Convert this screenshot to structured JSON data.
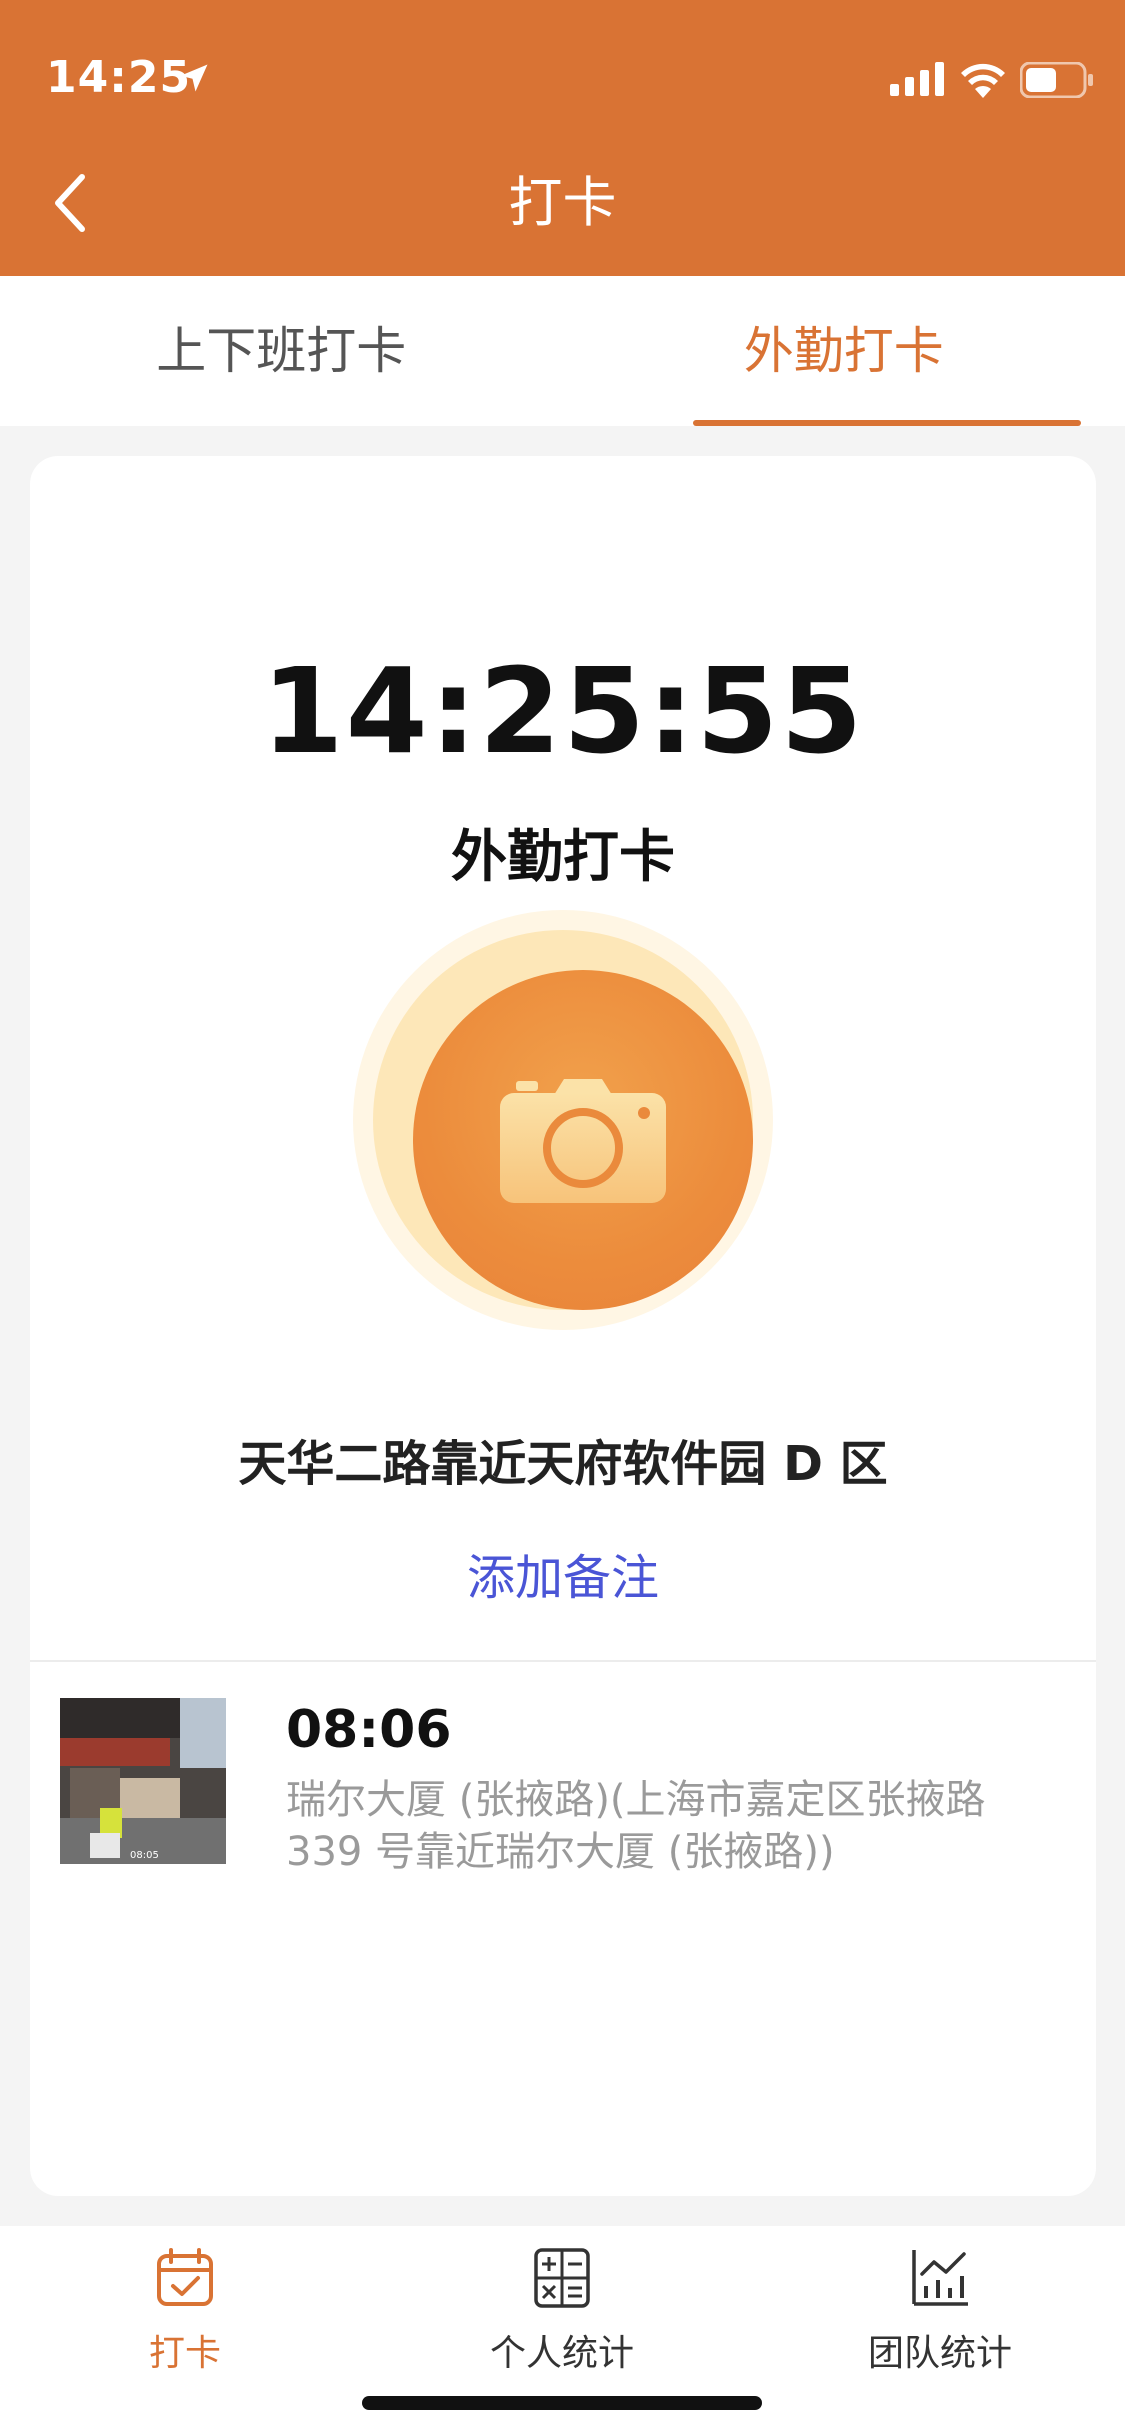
{
  "status_bar": {
    "time": "14:25",
    "icons": [
      "location-arrow-icon",
      "cellular-signal-icon",
      "wifi-icon",
      "battery-icon"
    ]
  },
  "header": {
    "title": "打卡",
    "back_icon": "chevron-left-icon",
    "background_color": "#d97334"
  },
  "tabs": [
    {
      "label": "上下班打卡",
      "active": false
    },
    {
      "label": "外勤打卡",
      "active": true
    }
  ],
  "punch_card": {
    "clock": "14:25:55",
    "mode": "外勤打卡",
    "button_icon": "camera-icon",
    "location": "天华二路靠近天府软件园 D 区",
    "add_note_label": "添加备注"
  },
  "records": [
    {
      "time": "08:06",
      "address": "瑞尔大厦 (张掖路)(上海市嘉定区张掖路 339 号靠近瑞尔大厦 (张掖路))",
      "photo_stamp": "08:05"
    }
  ],
  "bottom_nav": [
    {
      "label": "打卡",
      "icon": "calendar-check-icon",
      "active": true
    },
    {
      "label": "个人统计",
      "icon": "calculator-icon",
      "active": false
    },
    {
      "label": "团队统计",
      "icon": "bar-chart-icon",
      "active": false
    }
  ],
  "colors": {
    "accent": "#d97334",
    "link": "#4a55d6",
    "muted_text": "#9a9a9a"
  }
}
